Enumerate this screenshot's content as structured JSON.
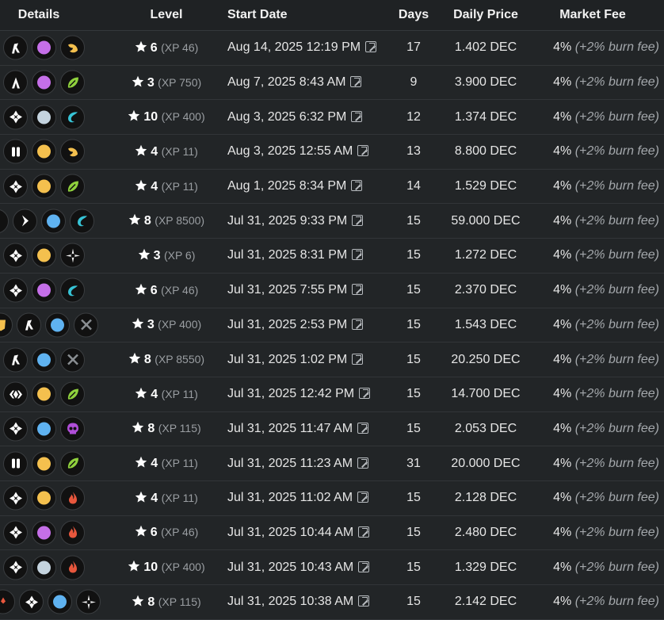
{
  "header": {
    "details": "Details",
    "level": "Level",
    "start_date": "Start Date",
    "days": "Days",
    "daily_price": "Daily Price",
    "market_fee": "Market Fee"
  },
  "colors": {
    "purple": "#c56fe8",
    "gold": "#f4c04e",
    "silver": "#c4d3de",
    "blue": "#5fb2f0",
    "green": "#8fd13d",
    "water": "#37c4d6",
    "fire": "#e8573d",
    "death": "#b04ed8"
  },
  "rows": [
    {
      "icons": [
        "sword",
        "purple",
        "earth-gold"
      ],
      "offset": 4,
      "level": "6",
      "xp": "(XP 46)",
      "date": "Aug 14, 2025 12:19 PM",
      "days": "17",
      "price": "1.402 DEC",
      "fee": "4%",
      "burn": "(+2% burn fee)"
    },
    {
      "icons": [
        "arrow",
        "purple",
        "life"
      ],
      "offset": 4,
      "level": "3",
      "xp": "(XP 750)",
      "date": "Aug 7, 2025 8:43 AM",
      "days": "9",
      "price": "3.900 DEC",
      "fee": "4%",
      "burn": "(+2% burn fee)"
    },
    {
      "icons": [
        "diamond",
        "silver",
        "water"
      ],
      "offset": 4,
      "level": "10",
      "xp": "(XP 400)",
      "date": "Aug 3, 2025 6:32 PM",
      "days": "12",
      "price": "1.374 DEC",
      "fee": "4%",
      "burn": "(+2% burn fee)"
    },
    {
      "icons": [
        "pause",
        "gold",
        "earth-gold"
      ],
      "offset": 4,
      "level": "4",
      "xp": "(XP 11)",
      "date": "Aug 3, 2025 12:55 AM",
      "days": "13",
      "price": "8.800 DEC",
      "fee": "4%",
      "burn": "(+2% burn fee)"
    },
    {
      "icons": [
        "diamond",
        "gold",
        "life"
      ],
      "offset": 4,
      "level": "4",
      "xp": "(XP 11)",
      "date": "Aug 1, 2025 8:34 PM",
      "days": "14",
      "price": "1.529 DEC",
      "fee": "4%",
      "burn": "(+2% burn fee)"
    },
    {
      "icons": [
        "fire-partial",
        "bolt",
        "blue",
        "water"
      ],
      "offset": -20,
      "level": "8",
      "xp": "(XP 8500)",
      "date": "Jul 31, 2025 9:33 PM",
      "days": "15",
      "price": "59.000 DEC",
      "fee": "4%",
      "burn": "(+2% burn fee)"
    },
    {
      "icons": [
        "diamond",
        "gold",
        "sparkle"
      ],
      "offset": 4,
      "level": "3",
      "xp": "(XP 6)",
      "date": "Jul 31, 2025 8:31 PM",
      "days": "15",
      "price": "1.272 DEC",
      "fee": "4%",
      "burn": "(+2% burn fee)"
    },
    {
      "icons": [
        "diamond",
        "purple",
        "water"
      ],
      "offset": 4,
      "level": "6",
      "xp": "(XP 46)",
      "date": "Jul 31, 2025 7:55 PM",
      "days": "15",
      "price": "2.370 DEC",
      "fee": "4%",
      "burn": "(+2% burn fee)"
    },
    {
      "icons": [
        "shield-gold",
        "sword",
        "blue",
        "cross"
      ],
      "offset": -15,
      "level": "3",
      "xp": "(XP 400)",
      "date": "Jul 31, 2025 2:53 PM",
      "days": "15",
      "price": "1.543 DEC",
      "fee": "4%",
      "burn": "(+2% burn fee)"
    },
    {
      "icons": [
        "sword",
        "blue",
        "cross"
      ],
      "offset": 4,
      "level": "8",
      "xp": "(XP 8550)",
      "date": "Jul 31, 2025 1:02 PM",
      "days": "15",
      "price": "20.250 DEC",
      "fee": "4%",
      "burn": "(+2% burn fee)"
    },
    {
      "icons": [
        "chevrons",
        "gold",
        "life"
      ],
      "offset": 4,
      "level": "4",
      "xp": "(XP 11)",
      "date": "Jul 31, 2025 12:42 PM",
      "days": "15",
      "price": "14.700 DEC",
      "fee": "4%",
      "burn": "(+2% burn fee)"
    },
    {
      "icons": [
        "diamond",
        "blue",
        "death"
      ],
      "offset": 4,
      "level": "8",
      "xp": "(XP 115)",
      "date": "Jul 31, 2025 11:47 AM",
      "days": "15",
      "price": "2.053 DEC",
      "fee": "4%",
      "burn": "(+2% burn fee)"
    },
    {
      "icons": [
        "pause",
        "gold",
        "life"
      ],
      "offset": 4,
      "level": "4",
      "xp": "(XP 11)",
      "date": "Jul 31, 2025 11:23 AM",
      "days": "31",
      "price": "20.000 DEC",
      "fee": "4%",
      "burn": "(+2% burn fee)"
    },
    {
      "icons": [
        "diamond",
        "gold",
        "fire"
      ],
      "offset": 4,
      "level": "4",
      "xp": "(XP 11)",
      "date": "Jul 31, 2025 11:02 AM",
      "days": "15",
      "price": "2.128 DEC",
      "fee": "4%",
      "burn": "(+2% burn fee)"
    },
    {
      "icons": [
        "diamond",
        "purple",
        "fire"
      ],
      "offset": 4,
      "level": "6",
      "xp": "(XP 46)",
      "date": "Jul 31, 2025 10:44 AM",
      "days": "15",
      "price": "2.480 DEC",
      "fee": "4%",
      "burn": "(+2% burn fee)"
    },
    {
      "icons": [
        "diamond",
        "silver",
        "fire"
      ],
      "offset": 4,
      "level": "10",
      "xp": "(XP 400)",
      "date": "Jul 31, 2025 10:43 AM",
      "days": "15",
      "price": "1.329 DEC",
      "fee": "4%",
      "burn": "(+2% burn fee)"
    },
    {
      "icons": [
        "partial-diamond",
        "diamond",
        "blue",
        "sparkle"
      ],
      "offset": -12,
      "level": "8",
      "xp": "(XP 115)",
      "date": "Jul 31, 2025 10:38 AM",
      "days": "15",
      "price": "2.142 DEC",
      "fee": "4%",
      "burn": "(+2% burn fee)"
    }
  ]
}
